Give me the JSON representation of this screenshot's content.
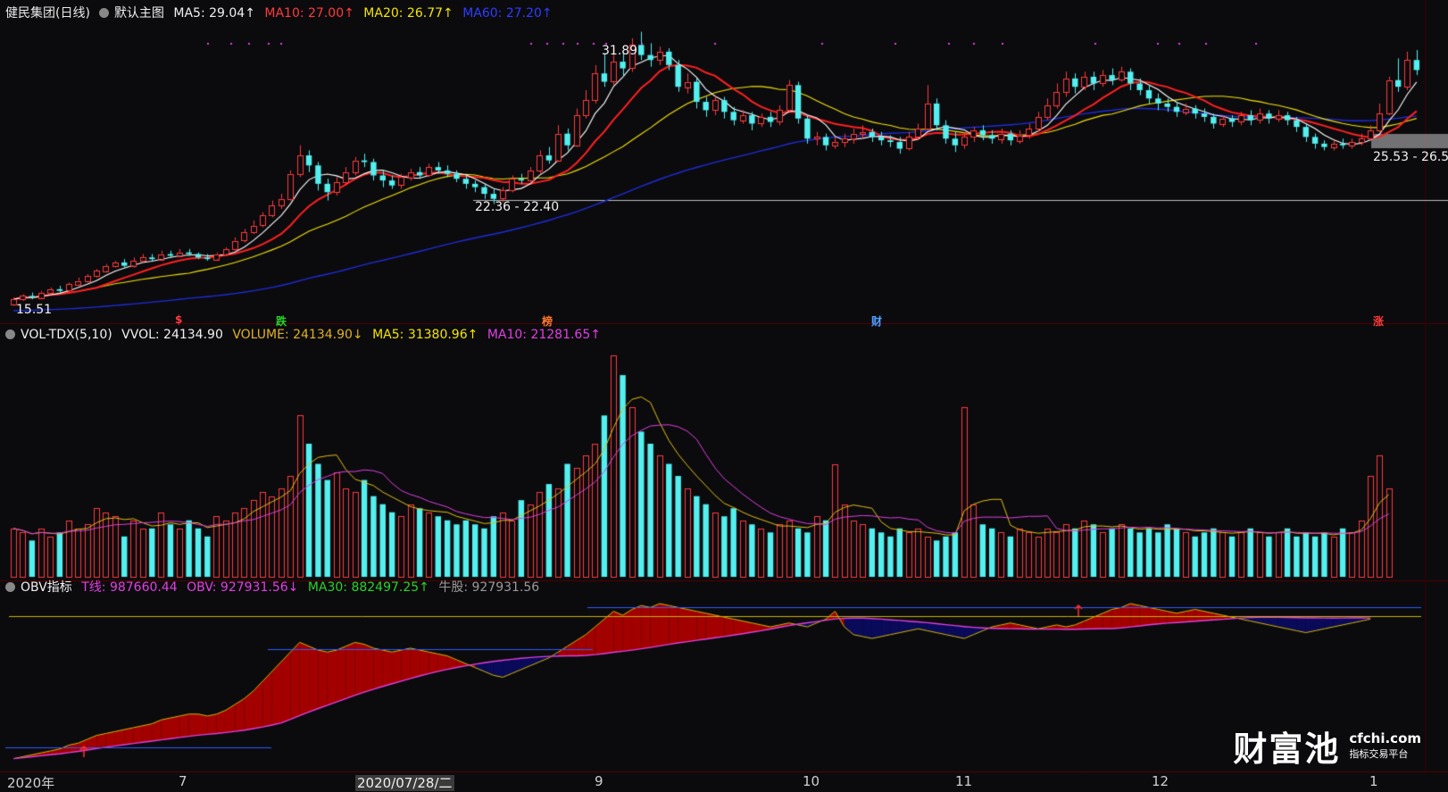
{
  "header_main": {
    "name": "健民集团(日线)",
    "indicator": "默认主图",
    "ma5": "MA5: 29.04↑",
    "ma10": "MA10: 27.00↑",
    "ma20": "MA20: 26.77↑",
    "ma60": "MA60: 27.20↑"
  },
  "header_vol": {
    "name": "VOL-TDX(5,10)",
    "vvol": "VVOL: 24134.90",
    "volume": "VOLUME: 24134.90↓",
    "ma5": "MA5: 31380.96↑",
    "ma10": "MA10: 21281.65↑"
  },
  "header_obv": {
    "name": "OBV指标",
    "t": "T线: 987660.44",
    "obv": "OBV: 927931.56↓",
    "ma30": "MA30: 882497.25↑",
    "bull": "牛股: 927931.56"
  },
  "annotations": {
    "high": "31.89",
    "low_left": "15.51",
    "range1": "22.36 - 22.40",
    "range2": "25.53 - 26.5"
  },
  "markers": [
    {
      "text": "$",
      "color": "#ff3b3b"
    },
    {
      "text": "跌",
      "color": "#29d329"
    },
    {
      "text": "榜",
      "color": "#ff7a2a"
    },
    {
      "text": "财",
      "color": "#4fa0ff"
    },
    {
      "text": "涨",
      "color": "#ff3b3b"
    }
  ],
  "x_axis": {
    "year": "2020年",
    "m7": "7",
    "cursor_date": "2020/07/28/二",
    "m9": "9",
    "m10": "10",
    "m11": "11",
    "m12": "12",
    "m1": "1"
  },
  "watermark": {
    "brand": "财富池",
    "domain": "cfchi.com",
    "sub": "指标交易平台"
  },
  "colors": {
    "up": "#ff3b3b",
    "down": "#54f0f0",
    "ma5": "#ffffff",
    "ma10": "#ff2020",
    "ma20": "#f5e400",
    "ma60": "#1f2cd8",
    "obv_fill": "#a30000",
    "obv_below": "#0a0a5a",
    "ma30_line": "#e040e0"
  },
  "chart_data": {
    "type": "candlestick",
    "stock": "健民集团",
    "period": "日线",
    "price_range_visible": [
      15.51,
      31.89
    ],
    "candles": [
      {
        "o": 15.6,
        "c": 15.9,
        "h": 16.0,
        "l": 15.5
      },
      {
        "o": 15.9,
        "c": 16.1,
        "h": 16.2,
        "l": 15.8
      },
      {
        "o": 16.1,
        "c": 16.0,
        "h": 16.3,
        "l": 15.9
      },
      {
        "o": 16.0,
        "c": 16.3,
        "h": 16.4,
        "l": 15.9
      },
      {
        "o": 16.3,
        "c": 16.5,
        "h": 16.6,
        "l": 16.2
      },
      {
        "o": 16.5,
        "c": 16.4,
        "h": 16.7,
        "l": 16.3
      },
      {
        "o": 16.4,
        "c": 16.8,
        "h": 16.9,
        "l": 16.3
      },
      {
        "o": 16.8,
        "c": 17.0,
        "h": 17.2,
        "l": 16.7
      },
      {
        "o": 17.0,
        "c": 17.3,
        "h": 17.4,
        "l": 16.9
      },
      {
        "o": 17.3,
        "c": 17.6,
        "h": 17.7,
        "l": 17.2
      },
      {
        "o": 17.6,
        "c": 17.9,
        "h": 18.0,
        "l": 17.5
      },
      {
        "o": 17.9,
        "c": 18.1,
        "h": 18.2,
        "l": 17.8
      },
      {
        "o": 18.1,
        "c": 17.9,
        "h": 18.3,
        "l": 17.8
      },
      {
        "o": 17.9,
        "c": 18.2,
        "h": 18.4,
        "l": 17.8
      },
      {
        "o": 18.2,
        "c": 18.4,
        "h": 18.6,
        "l": 18.1
      },
      {
        "o": 18.4,
        "c": 18.3,
        "h": 18.6,
        "l": 18.2
      },
      {
        "o": 18.3,
        "c": 18.6,
        "h": 18.8,
        "l": 18.2
      },
      {
        "o": 18.6,
        "c": 18.5,
        "h": 18.8,
        "l": 18.4
      },
      {
        "o": 18.5,
        "c": 18.7,
        "h": 18.9,
        "l": 18.4
      },
      {
        "o": 18.7,
        "c": 18.6,
        "h": 18.9,
        "l": 18.5
      },
      {
        "o": 18.6,
        "c": 18.4,
        "h": 18.7,
        "l": 18.3
      },
      {
        "o": 18.4,
        "c": 18.3,
        "h": 18.6,
        "l": 18.2
      },
      {
        "o": 18.3,
        "c": 18.6,
        "h": 18.7,
        "l": 18.2
      },
      {
        "o": 18.6,
        "c": 18.9,
        "h": 19.0,
        "l": 18.5
      },
      {
        "o": 18.9,
        "c": 19.4,
        "h": 19.6,
        "l": 18.8
      },
      {
        "o": 19.4,
        "c": 19.9,
        "h": 20.1,
        "l": 19.3
      },
      {
        "o": 19.9,
        "c": 20.3,
        "h": 20.6,
        "l": 19.8
      },
      {
        "o": 20.3,
        "c": 20.9,
        "h": 21.1,
        "l": 20.2
      },
      {
        "o": 20.9,
        "c": 21.5,
        "h": 21.8,
        "l": 20.8
      },
      {
        "o": 21.5,
        "c": 21.9,
        "h": 22.2,
        "l": 21.3
      },
      {
        "o": 21.9,
        "c": 23.4,
        "h": 23.6,
        "l": 21.8
      },
      {
        "o": 23.4,
        "c": 24.5,
        "h": 25.1,
        "l": 23.2
      },
      {
        "o": 24.5,
        "c": 23.9,
        "h": 24.8,
        "l": 23.5
      },
      {
        "o": 23.9,
        "c": 22.8,
        "h": 24.1,
        "l": 22.4
      },
      {
        "o": 22.8,
        "c": 22.3,
        "h": 23.1,
        "l": 21.8
      },
      {
        "o": 22.3,
        "c": 22.9,
        "h": 23.2,
        "l": 22.1
      },
      {
        "o": 22.9,
        "c": 23.5,
        "h": 23.8,
        "l": 22.7
      },
      {
        "o": 23.5,
        "c": 24.2,
        "h": 24.4,
        "l": 23.3
      },
      {
        "o": 24.2,
        "c": 24.1,
        "h": 24.6,
        "l": 23.8
      },
      {
        "o": 24.1,
        "c": 23.3,
        "h": 24.3,
        "l": 23.0
      },
      {
        "o": 23.3,
        "c": 23.0,
        "h": 23.6,
        "l": 22.6
      },
      {
        "o": 23.0,
        "c": 22.7,
        "h": 23.3,
        "l": 22.5
      },
      {
        "o": 22.7,
        "c": 23.2,
        "h": 23.4,
        "l": 22.5
      },
      {
        "o": 23.2,
        "c": 23.5,
        "h": 23.7,
        "l": 23.0
      },
      {
        "o": 23.5,
        "c": 23.3,
        "h": 23.8,
        "l": 23.1
      },
      {
        "o": 23.3,
        "c": 23.8,
        "h": 24.0,
        "l": 23.2
      },
      {
        "o": 23.8,
        "c": 23.6,
        "h": 24.1,
        "l": 23.4
      },
      {
        "o": 23.6,
        "c": 23.4,
        "h": 23.9,
        "l": 23.2
      },
      {
        "o": 23.4,
        "c": 23.1,
        "h": 23.6,
        "l": 22.9
      },
      {
        "o": 23.1,
        "c": 22.8,
        "h": 23.3,
        "l": 22.5
      },
      {
        "o": 22.8,
        "c": 22.6,
        "h": 23.0,
        "l": 22.3
      },
      {
        "o": 22.6,
        "c": 22.2,
        "h": 22.8,
        "l": 21.9
      },
      {
        "o": 22.2,
        "c": 21.9,
        "h": 22.5,
        "l": 21.6
      },
      {
        "o": 21.9,
        "c": 22.4,
        "h": 22.6,
        "l": 21.7
      },
      {
        "o": 22.4,
        "c": 23.1,
        "h": 23.3,
        "l": 22.3
      },
      {
        "o": 23.1,
        "c": 23.0,
        "h": 23.4,
        "l": 22.8
      },
      {
        "o": 23.0,
        "c": 23.6,
        "h": 23.8,
        "l": 22.9
      },
      {
        "o": 23.6,
        "c": 24.5,
        "h": 24.8,
        "l": 23.4
      },
      {
        "o": 24.5,
        "c": 24.2,
        "h": 25.0,
        "l": 24.0
      },
      {
        "o": 24.2,
        "c": 25.8,
        "h": 26.3,
        "l": 24.1
      },
      {
        "o": 25.8,
        "c": 25.1,
        "h": 26.1,
        "l": 24.8
      },
      {
        "o": 25.1,
        "c": 26.9,
        "h": 27.3,
        "l": 25.0
      },
      {
        "o": 26.9,
        "c": 27.8,
        "h": 28.4,
        "l": 26.7
      },
      {
        "o": 27.8,
        "c": 29.4,
        "h": 29.9,
        "l": 27.6
      },
      {
        "o": 29.4,
        "c": 28.9,
        "h": 30.6,
        "l": 28.6
      },
      {
        "o": 28.9,
        "c": 30.1,
        "h": 30.9,
        "l": 28.7
      },
      {
        "o": 30.1,
        "c": 29.7,
        "h": 30.6,
        "l": 29.2
      },
      {
        "o": 29.7,
        "c": 31.1,
        "h": 31.5,
        "l": 29.5
      },
      {
        "o": 31.1,
        "c": 30.5,
        "h": 31.89,
        "l": 30.2
      },
      {
        "o": 30.5,
        "c": 30.2,
        "h": 31.2,
        "l": 29.8
      },
      {
        "o": 30.2,
        "c": 30.7,
        "h": 31.0,
        "l": 29.9
      },
      {
        "o": 30.7,
        "c": 29.9,
        "h": 30.9,
        "l": 29.6
      },
      {
        "o": 29.9,
        "c": 28.6,
        "h": 30.2,
        "l": 28.3
      },
      {
        "o": 28.6,
        "c": 28.9,
        "h": 29.4,
        "l": 28.2
      },
      {
        "o": 28.9,
        "c": 27.7,
        "h": 29.1,
        "l": 27.3
      },
      {
        "o": 27.7,
        "c": 27.2,
        "h": 28.0,
        "l": 26.8
      },
      {
        "o": 27.2,
        "c": 27.8,
        "h": 28.1,
        "l": 26.9
      },
      {
        "o": 27.8,
        "c": 27.1,
        "h": 28.0,
        "l": 26.7
      },
      {
        "o": 27.1,
        "c": 26.6,
        "h": 27.4,
        "l": 26.3
      },
      {
        "o": 26.6,
        "c": 26.9,
        "h": 27.2,
        "l": 26.4
      },
      {
        "o": 26.9,
        "c": 26.4,
        "h": 27.1,
        "l": 26.0
      },
      {
        "o": 26.4,
        "c": 26.8,
        "h": 27.0,
        "l": 26.2
      },
      {
        "o": 26.8,
        "c": 26.5,
        "h": 27.1,
        "l": 26.2
      },
      {
        "o": 26.5,
        "c": 27.2,
        "h": 27.5,
        "l": 26.3
      },
      {
        "o": 27.2,
        "c": 28.7,
        "h": 29.0,
        "l": 27.1
      },
      {
        "o": 28.7,
        "c": 26.7,
        "h": 28.9,
        "l": 26.4
      },
      {
        "o": 26.7,
        "c": 25.5,
        "h": 26.9,
        "l": 25.2
      },
      {
        "o": 25.5,
        "c": 25.6,
        "h": 25.9,
        "l": 25.1
      },
      {
        "o": 25.6,
        "c": 25.1,
        "h": 25.8,
        "l": 24.8
      },
      {
        "o": 25.1,
        "c": 25.3,
        "h": 25.6,
        "l": 24.9
      },
      {
        "o": 25.3,
        "c": 25.5,
        "h": 25.8,
        "l": 25.0
      },
      {
        "o": 25.5,
        "c": 25.8,
        "h": 26.1,
        "l": 25.2
      },
      {
        "o": 25.8,
        "c": 25.9,
        "h": 26.3,
        "l": 25.5
      },
      {
        "o": 25.9,
        "c": 25.6,
        "h": 26.1,
        "l": 25.3
      },
      {
        "o": 25.6,
        "c": 25.4,
        "h": 25.9,
        "l": 25.1
      },
      {
        "o": 25.4,
        "c": 25.3,
        "h": 25.7,
        "l": 25.0
      },
      {
        "o": 25.3,
        "c": 24.9,
        "h": 25.6,
        "l": 24.6
      },
      {
        "o": 24.9,
        "c": 25.6,
        "h": 25.9,
        "l": 24.8
      },
      {
        "o": 25.6,
        "c": 26.1,
        "h": 26.4,
        "l": 25.4
      },
      {
        "o": 26.1,
        "c": 27.6,
        "h": 28.7,
        "l": 26.0
      },
      {
        "o": 27.6,
        "c": 26.3,
        "h": 27.9,
        "l": 26.0
      },
      {
        "o": 26.3,
        "c": 25.5,
        "h": 26.6,
        "l": 25.2
      },
      {
        "o": 25.5,
        "c": 25.1,
        "h": 25.9,
        "l": 24.7
      },
      {
        "o": 25.1,
        "c": 25.6,
        "h": 25.9,
        "l": 24.9
      },
      {
        "o": 25.6,
        "c": 26.0,
        "h": 26.2,
        "l": 25.3
      },
      {
        "o": 26.0,
        "c": 25.7,
        "h": 26.3,
        "l": 25.4
      },
      {
        "o": 25.7,
        "c": 25.5,
        "h": 26.0,
        "l": 25.2
      },
      {
        "o": 25.5,
        "c": 25.8,
        "h": 26.1,
        "l": 25.2
      },
      {
        "o": 25.8,
        "c": 25.4,
        "h": 26.0,
        "l": 25.1
      },
      {
        "o": 25.4,
        "c": 25.7,
        "h": 26.0,
        "l": 25.2
      },
      {
        "o": 25.7,
        "c": 26.1,
        "h": 26.4,
        "l": 25.5
      },
      {
        "o": 26.1,
        "c": 26.8,
        "h": 27.1,
        "l": 25.9
      },
      {
        "o": 26.8,
        "c": 27.5,
        "h": 27.9,
        "l": 26.6
      },
      {
        "o": 27.5,
        "c": 28.3,
        "h": 28.8,
        "l": 27.3
      },
      {
        "o": 28.3,
        "c": 29.1,
        "h": 29.5,
        "l": 28.0
      },
      {
        "o": 29.1,
        "c": 28.6,
        "h": 29.4,
        "l": 28.2
      },
      {
        "o": 28.6,
        "c": 29.2,
        "h": 29.5,
        "l": 28.4
      },
      {
        "o": 29.2,
        "c": 28.8,
        "h": 29.5,
        "l": 28.4
      },
      {
        "o": 28.8,
        "c": 29.3,
        "h": 29.6,
        "l": 28.6
      },
      {
        "o": 29.3,
        "c": 29.0,
        "h": 29.7,
        "l": 28.7
      },
      {
        "o": 29.0,
        "c": 29.5,
        "h": 29.8,
        "l": 28.9
      },
      {
        "o": 29.5,
        "c": 28.8,
        "h": 29.7,
        "l": 28.4
      },
      {
        "o": 28.8,
        "c": 28.4,
        "h": 29.1,
        "l": 28.1
      },
      {
        "o": 28.4,
        "c": 27.9,
        "h": 28.7,
        "l": 27.6
      },
      {
        "o": 27.9,
        "c": 27.6,
        "h": 28.2,
        "l": 27.2
      },
      {
        "o": 27.6,
        "c": 27.4,
        "h": 27.9,
        "l": 27.1
      },
      {
        "o": 27.4,
        "c": 27.1,
        "h": 27.7,
        "l": 26.8
      },
      {
        "o": 27.1,
        "c": 27.3,
        "h": 27.6,
        "l": 26.9
      },
      {
        "o": 27.3,
        "c": 27.0,
        "h": 27.5,
        "l": 26.7
      },
      {
        "o": 27.0,
        "c": 26.8,
        "h": 27.3,
        "l": 26.5
      },
      {
        "o": 26.8,
        "c": 26.4,
        "h": 27.0,
        "l": 26.1
      },
      {
        "o": 26.4,
        "c": 26.7,
        "h": 26.9,
        "l": 26.2
      },
      {
        "o": 26.7,
        "c": 26.5,
        "h": 26.9,
        "l": 26.2
      },
      {
        "o": 26.5,
        "c": 26.9,
        "h": 27.1,
        "l": 26.3
      },
      {
        "o": 26.9,
        "c": 26.6,
        "h": 27.2,
        "l": 26.3
      },
      {
        "o": 26.6,
        "c": 27.0,
        "h": 27.3,
        "l": 26.4
      },
      {
        "o": 27.0,
        "c": 26.7,
        "h": 27.2,
        "l": 26.4
      },
      {
        "o": 26.7,
        "c": 26.9,
        "h": 27.2,
        "l": 26.5
      },
      {
        "o": 26.9,
        "c": 26.6,
        "h": 27.1,
        "l": 26.3
      },
      {
        "o": 26.6,
        "c": 26.2,
        "h": 26.8,
        "l": 25.9
      },
      {
        "o": 26.2,
        "c": 25.6,
        "h": 26.4,
        "l": 25.3
      },
      {
        "o": 25.6,
        "c": 25.2,
        "h": 25.8,
        "l": 24.9
      },
      {
        "o": 25.2,
        "c": 25.0,
        "h": 25.4,
        "l": 24.8
      },
      {
        "o": 25.0,
        "c": 25.2,
        "h": 25.4,
        "l": 24.8
      },
      {
        "o": 25.2,
        "c": 25.1,
        "h": 25.5,
        "l": 24.9
      },
      {
        "o": 25.1,
        "c": 25.3,
        "h": 25.5,
        "l": 24.9
      },
      {
        "o": 25.3,
        "c": 25.5,
        "h": 25.8,
        "l": 25.1
      },
      {
        "o": 25.5,
        "c": 26.0,
        "h": 26.3,
        "l": 25.4
      },
      {
        "o": 26.0,
        "c": 27.0,
        "h": 27.6,
        "l": 25.9
      },
      {
        "o": 27.0,
        "c": 29.0,
        "h": 29.2,
        "l": 26.9
      },
      {
        "o": 29.0,
        "c": 28.6,
        "h": 30.3,
        "l": 28.3
      },
      {
        "o": 28.6,
        "c": 30.2,
        "h": 30.7,
        "l": 28.4
      },
      {
        "o": 30.2,
        "c": 29.6,
        "h": 30.8,
        "l": 29.3
      }
    ],
    "volume_series": {
      "name": "VOLUME",
      "values": [
        12,
        11,
        9,
        12,
        10,
        11,
        14,
        12,
        13,
        17,
        16,
        15,
        10,
        14,
        12,
        12,
        16,
        13,
        12,
        14,
        12,
        10,
        15,
        14,
        16,
        17,
        19,
        21,
        20,
        22,
        25,
        40,
        33,
        28,
        24,
        26,
        22,
        21,
        24,
        20,
        18,
        16,
        15,
        18,
        17,
        16,
        15,
        14,
        13,
        14,
        13,
        12,
        15,
        16,
        14,
        19,
        18,
        21,
        23,
        22,
        28,
        27,
        30,
        33,
        40,
        55,
        50,
        42,
        36,
        33,
        30,
        28,
        25,
        22,
        20,
        18,
        16,
        15,
        17,
        14,
        13,
        12,
        11,
        13,
        14,
        12,
        11,
        15,
        14,
        28,
        18,
        14,
        13,
        12,
        11,
        10,
        12,
        11,
        12,
        10,
        9,
        10,
        11,
        42,
        18,
        13,
        12,
        11,
        10,
        12,
        11,
        10,
        12,
        11,
        13,
        12,
        14,
        13,
        11,
        12,
        13,
        12,
        11,
        12,
        11,
        13,
        12,
        11,
        10,
        11,
        12,
        11,
        10,
        11,
        12,
        11,
        10,
        11,
        12,
        10,
        11,
        10,
        11,
        10,
        12,
        11,
        14,
        25,
        30,
        22
      ],
      "vol_ma5_label": "MA5",
      "vol_ma10_label": "MA10"
    },
    "obv_series": {
      "name": "OBV",
      "values": [
        2,
        3,
        4,
        5,
        6,
        7,
        9,
        10,
        12,
        14,
        15,
        16,
        17,
        18,
        19,
        20,
        22,
        23,
        24,
        25,
        25,
        24,
        25,
        27,
        30,
        33,
        37,
        42,
        47,
        52,
        57,
        62,
        60,
        58,
        57,
        58,
        60,
        62,
        61,
        59,
        58,
        57,
        58,
        59,
        58,
        57,
        56,
        55,
        53,
        51,
        49,
        47,
        45,
        44,
        46,
        48,
        50,
        52,
        54,
        57,
        60,
        63,
        66,
        70,
        74,
        78,
        76,
        79,
        81,
        80,
        82,
        81,
        80,
        79,
        78,
        77,
        76,
        75,
        74,
        73,
        72,
        71,
        70,
        71,
        72,
        71,
        70,
        72,
        74,
        78,
        70,
        66,
        65,
        64,
        65,
        66,
        67,
        68,
        69,
        68,
        67,
        66,
        65,
        64,
        66,
        68,
        70,
        71,
        72,
        71,
        70,
        69,
        70,
        71,
        70,
        71,
        73,
        75,
        77,
        79,
        80,
        82,
        81,
        80,
        79,
        78,
        77,
        78,
        79,
        78,
        77,
        76,
        75,
        74,
        73,
        72,
        71,
        70,
        69,
        68,
        67,
        68,
        69,
        70,
        71,
        72,
        73,
        74
      ],
      "ma30_label": "MA30"
    }
  }
}
